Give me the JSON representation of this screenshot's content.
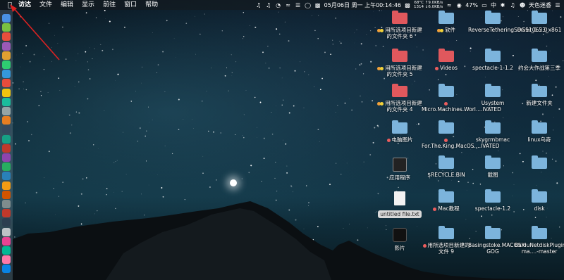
{
  "menubar": {
    "app_name": "访达",
    "menus": [
      "文件",
      "编辑",
      "显示",
      "前往",
      "窗口",
      "帮助"
    ],
    "net_stats_top": "68°C ↑9.0KB/s",
    "net_stats_bottom": "1314 ↓6.0KB/s",
    "datetime": "05月06日 周一 上午00:14:46",
    "battery": "47%",
    "input_method": "中",
    "user": "天色迷香"
  },
  "desktop": {
    "icons": [
      {
        "label": "用所选项目新建的文件夹 6",
        "type": "red-folder",
        "tags": [
          "orange",
          "yellow"
        ]
      },
      {
        "label": "软件",
        "type": "folder",
        "tags": [
          "orange",
          "yellow"
        ]
      },
      {
        "label": "ReverseTetheringServer_1.2.0",
        "type": "folder",
        "tags": []
      },
      {
        "label": "DG510653_x861",
        "type": "folder",
        "tags": []
      },
      {
        "label": "用所选项目新建的文件夹 5",
        "type": "red-folder",
        "tags": [
          "orange",
          "yellow"
        ]
      },
      {
        "label": "Videos",
        "type": "red-folder",
        "tags": [
          "red"
        ]
      },
      {
        "label": "spectacle-1-1.2",
        "type": "folder",
        "tags": []
      },
      {
        "label": "约会大作战第三季",
        "type": "folder",
        "tags": []
      },
      {
        "label": "用所选项目新建的文件夹 4",
        "type": "red-folder",
        "tags": [
          "orange",
          "yellow"
        ]
      },
      {
        "label": "Micro.Machines.Worl....IVATED",
        "type": "folder",
        "tags": [
          "red"
        ]
      },
      {
        "label": "Usystem",
        "type": "folder",
        "tags": []
      },
      {
        "label": "新建文件夹",
        "type": "folder",
        "tags": []
      },
      {
        "label": "电脑图片",
        "type": "folder",
        "tags": [
          "red"
        ]
      },
      {
        "label": "For.The.King.MacOS....IVATED",
        "type": "folder",
        "tags": [
          "red"
        ]
      },
      {
        "label": "skygrmbmac",
        "type": "folder",
        "tags": []
      },
      {
        "label": "linux乌奇",
        "type": "folder",
        "tags": []
      },
      {
        "label": "应用程序",
        "type": "terminal",
        "tags": []
      },
      {
        "label": "$RECYCLE.BIN",
        "type": "folder",
        "tags": []
      },
      {
        "label": "截图",
        "type": "folder",
        "tags": []
      },
      {
        "label": "",
        "type": "folder",
        "tags": []
      },
      {
        "label": "untitled file.txt",
        "type": "file",
        "tags": []
      },
      {
        "label": "Mac教程",
        "type": "folder",
        "tags": [
          "red"
        ]
      },
      {
        "label": "spectacle-1.2",
        "type": "folder",
        "tags": []
      },
      {
        "label": "disk",
        "type": "folder",
        "tags": []
      },
      {
        "label": "影片",
        "type": "movie",
        "tags": []
      },
      {
        "label": "用所选项目新建的文件 9",
        "type": "folder",
        "tags": [
          "red"
        ]
      },
      {
        "label": "Basingstoke.MACOSX-GOG",
        "type": "folder",
        "tags": []
      },
      {
        "label": "BaiduNetdiskPlugin-ma....-master",
        "type": "folder",
        "tags": []
      }
    ]
  },
  "colors": {
    "folder_blue": "#7cb4dc",
    "folder_red": "#e0585d",
    "tag_orange": "#f2a23a",
    "tag_red": "#ec5d5d"
  }
}
